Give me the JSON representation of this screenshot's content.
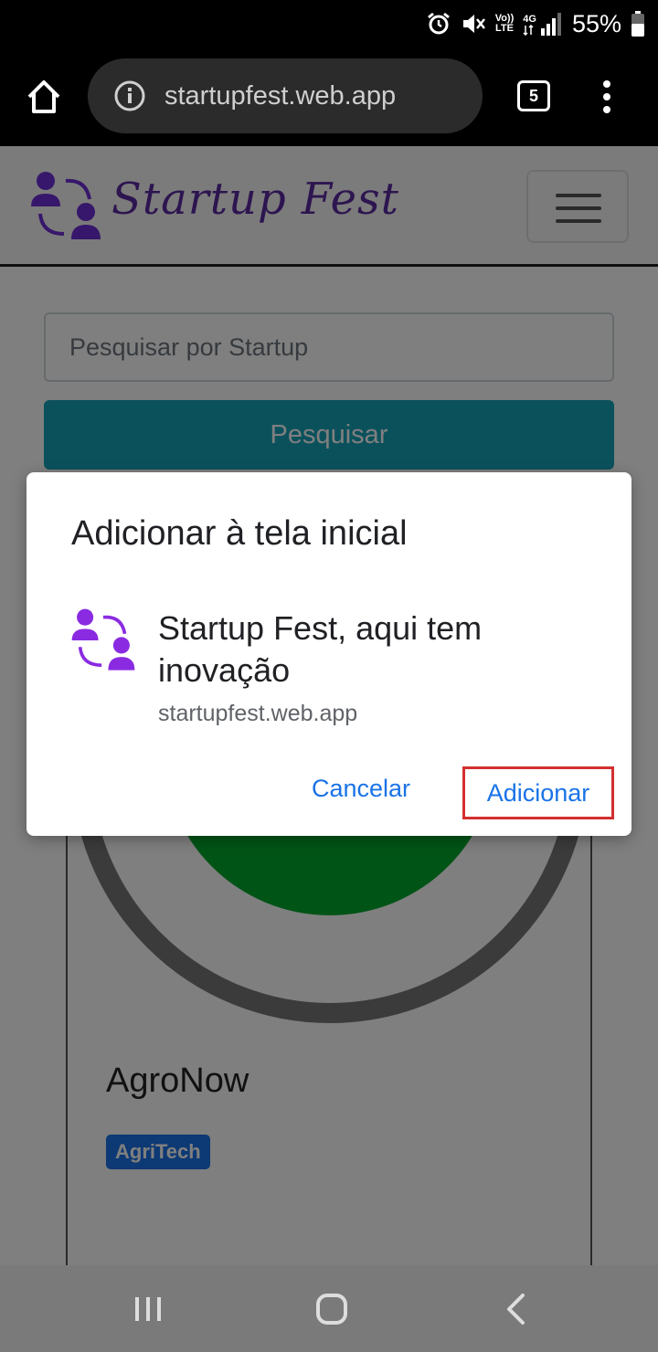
{
  "status_bar": {
    "network_top": "Vo))",
    "network_bottom": "LTE",
    "signal_type": "4G",
    "battery": "55%",
    "icons": [
      "alarm-icon",
      "mute-icon",
      "volte-icon",
      "signal-icon",
      "battery-icon"
    ]
  },
  "browser": {
    "url": "startupfest.web.app",
    "tab_count": "5"
  },
  "site": {
    "logo_text": "Startup Fest",
    "search_placeholder": "Pesquisar por Startup",
    "search_button": "Pesquisar",
    "card": {
      "title": "AgroNow",
      "badge": "AgriTech"
    }
  },
  "dialog": {
    "title": "Adicionar à tela inicial",
    "app_name": "Startup Fest, aqui tem inovação",
    "app_url": "startupfest.web.app",
    "cancel_label": "Cancelar",
    "add_label": "Adicionar"
  },
  "colors": {
    "brand_purple": "#6f2fd6",
    "link_blue": "#1a73e8",
    "highlight_red": "#d32f2f",
    "search_button_teal": "#17a2b8"
  }
}
